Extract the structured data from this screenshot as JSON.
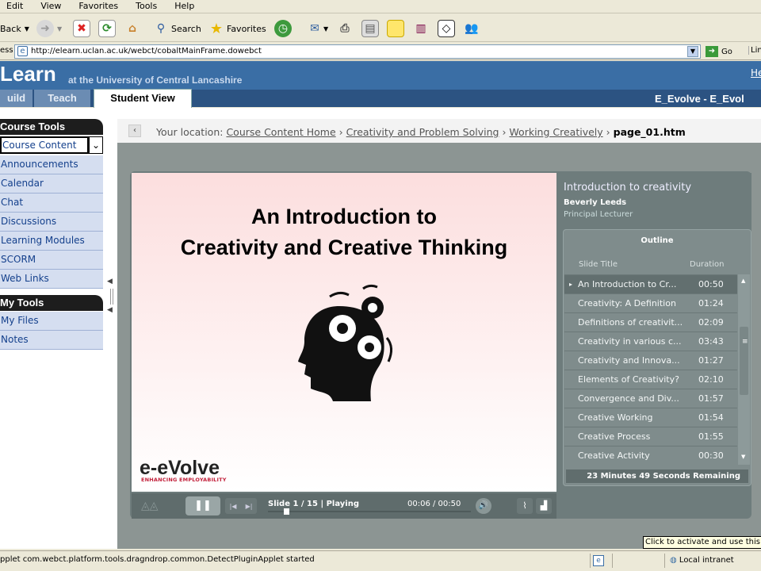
{
  "menubar": {
    "items": [
      "Edit",
      "View",
      "Favorites",
      "Tools",
      "Help"
    ]
  },
  "toolbar": {
    "back": "Back",
    "search": "Search",
    "favorites": "Favorites"
  },
  "address": {
    "label": "ess",
    "url": "http://elearn.uclan.ac.uk/webct/cobaltMainFrame.dowebct",
    "go": "Go",
    "links": "Lin"
  },
  "header": {
    "logo": "Learn",
    "subtitle": "at the University of Central Lancashire",
    "help": "He"
  },
  "tabs": [
    {
      "label": "uild"
    },
    {
      "label": "Teach"
    },
    {
      "label": "Student View"
    }
  ],
  "course": "E_Evolve - E_Evol",
  "sidebar": {
    "course_tools": "Course Tools",
    "items": [
      "Course Content",
      "Announcements",
      "Calendar",
      "Chat",
      "Discussions",
      "Learning Modules",
      "SCORM",
      "Web Links"
    ],
    "my_tools": "My Tools",
    "my_items": [
      "My Files",
      "Notes"
    ]
  },
  "breadcrumb": {
    "label": "Your location:",
    "links": [
      "Course Content Home",
      "Creativity and Problem Solving",
      "Working Creatively"
    ],
    "current": "page_01.htm",
    "sep": "›"
  },
  "slide": {
    "title_line1": "An Introduction to",
    "title_line2": "Creativity and Creative Thinking",
    "logo_main": "e-eVolve",
    "logo_sub": "ENHANCING EMPLOYABILITY"
  },
  "panel": {
    "title": "Introduction to creativity",
    "author": "Beverly Leeds",
    "role": "Principal Lecturer",
    "outline": "Outline",
    "col_title": "Slide Title",
    "col_duration": "Duration",
    "rows": [
      {
        "t": "An Introduction to  Cr...",
        "d": "00:50"
      },
      {
        "t": "Creativity: A Definition",
        "d": "01:24"
      },
      {
        "t": "Definitions of creativit...",
        "d": "02:09"
      },
      {
        "t": "Creativity in various c...",
        "d": "03:43"
      },
      {
        "t": "Creativity and Innova...",
        "d": "01:27"
      },
      {
        "t": "Elements of Creativity?",
        "d": "02:10"
      },
      {
        "t": "Convergence and Div...",
        "d": "01:57"
      },
      {
        "t": "Creative Working",
        "d": "01:54"
      },
      {
        "t": "Creative Process",
        "d": "01:55"
      },
      {
        "t": "Creative Activity",
        "d": "00:30"
      }
    ],
    "remaining": "23 Minutes 49 Seconds Remaining"
  },
  "controls": {
    "slide_info": "Slide 1 / 15 | Playing",
    "time": "00:06 / 00:50"
  },
  "status": {
    "text": "pplet com.webct.platform.tools.dragndrop.common.DetectPluginApplet started",
    "zone": "Local intranet",
    "tooltip": "Click to activate and use this co"
  },
  "colors": {
    "header": "#3a6ea5",
    "nav_bg": "#d5def0",
    "nav_text": "#14408c",
    "player": "#6e7c7c"
  }
}
